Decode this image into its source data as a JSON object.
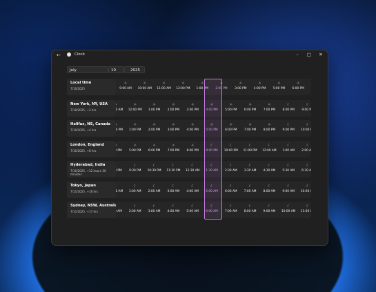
{
  "window": {
    "title": "Clock",
    "back_icon": "←",
    "minimize_icon": "–",
    "maximize_icon": "□",
    "close_icon": "✕"
  },
  "date": {
    "month": "July",
    "day": "10",
    "year": "2025"
  },
  "icons": {
    "sun": "☼",
    "moon": "☾"
  },
  "rows": [
    {
      "name": "Local time",
      "meta": "7/10/2025",
      "start_icon": "sun",
      "moon_from": 99,
      "times": [
        "9:00 AM",
        "10:00 AM",
        "11:00 AM",
        "12:00 PM",
        "1:00 PM",
        "2:00 PM",
        "3:00 PM",
        "4:00 PM",
        "5:00 PM",
        "6:00 PM"
      ]
    },
    {
      "name": "New York, NY, USA",
      "meta": "7/10/2025, +3 hrs",
      "moon_from": 9,
      "times": [
        "11:00 AM",
        "12:00 PM",
        "1:00 PM",
        "2:00 PM",
        "3:00 PM",
        "4:00 PM",
        "5:00 PM",
        "6:00 PM",
        "7:00 PM",
        "8:00 PM",
        "9:00 PM"
      ]
    },
    {
      "name": "Halifax, NS, Canada",
      "meta": "7/10/2025, +4 hrs",
      "moon_from": 9,
      "times": [
        "12:00 PM",
        "1:00 PM",
        "2:00 PM",
        "3:00 PM",
        "4:00 PM",
        "5:00 PM",
        "6:00 PM",
        "7:00 PM",
        "8:00 PM",
        "9:00 PM",
        "10:00 PM"
      ]
    },
    {
      "name": "London, England",
      "meta": "7/10/2025, +8 hrs",
      "moon_from": 5,
      "times": [
        "4:00 PM",
        "5:00 PM",
        "6:00 PM",
        "7:00 PM",
        "8:00 PM",
        "9:00 PM",
        "10:00 PM",
        "11:00 PM",
        "12:00 AM",
        "1:00 AM",
        "2:00 AM"
      ]
    },
    {
      "name": "Hyderabad, India",
      "meta": "7/10/2025, +12 hours 30 minutes",
      "moon_from": 0,
      "times": [
        "8:30 PM",
        "9:30 PM",
        "10:30 PM",
        "11:30 PM",
        "12:30 AM",
        "1:30 AM",
        "2:30 AM",
        "3:30 AM",
        "4:30 AM",
        "5:30 AM",
        "6:30 AM"
      ]
    },
    {
      "name": "Tokyo, Japan",
      "meta": "7/11/2025, +16 hrs",
      "moon_from": 0,
      "times": [
        "12:00 AM",
        "1:00 AM",
        "2:00 AM",
        "3:00 AM",
        "4:00 AM",
        "5:00 AM",
        "6:00 AM",
        "7:00 AM",
        "8:00 AM",
        "9:00 AM",
        "10:00 AM"
      ]
    },
    {
      "name": "Sydney, NSW, Australia",
      "meta": "7/11/2025, +17 hrs",
      "moon_from": 0,
      "times": [
        "1:00 AM",
        "2:00 AM",
        "3:00 AM",
        "4:00 AM",
        "5:00 AM",
        "6:00 AM",
        "7:00 AM",
        "8:00 AM",
        "9:00 AM",
        "10:00 AM",
        "11:00 AM"
      ]
    }
  ],
  "selected_column": 5
}
